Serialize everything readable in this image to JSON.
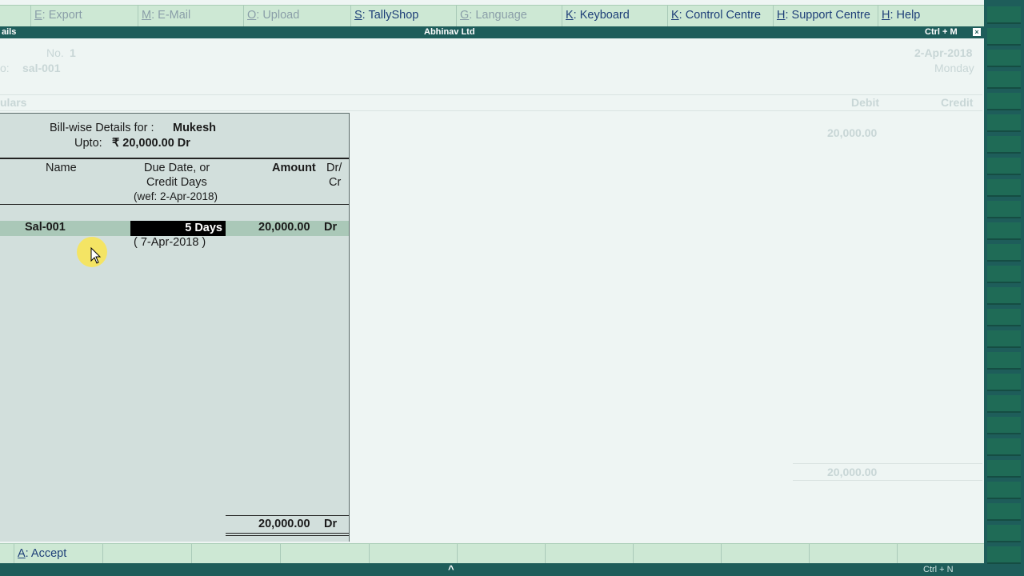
{
  "top_menu": [
    {
      "key": "E",
      "label": ": Export",
      "enabled": false
    },
    {
      "key": "M",
      "label": ": E-Mail",
      "enabled": false
    },
    {
      "key": "O",
      "label": ": Upload",
      "enabled": false
    },
    {
      "key": "S",
      "label": ": TallyShop",
      "enabled": true
    },
    {
      "key": "G",
      "label": ": Language",
      "enabled": false
    },
    {
      "key": "K",
      "label": ": Keyboard",
      "enabled": true
    },
    {
      "key": "K",
      "label": ": Control Centre",
      "enabled": true
    },
    {
      "key": "H",
      "label": ": Support Centre",
      "enabled": true
    },
    {
      "key": "H",
      "label": ": Help",
      "enabled": true
    }
  ],
  "titlebar": {
    "left": "ails",
    "company": "Abhinav Ltd",
    "shortcut": "Ctrl + M",
    "close": "×"
  },
  "voucher_bg": {
    "no_label": "No.",
    "no_value": "1",
    "ref_label": "o:",
    "ref_value": "sal-001",
    "date": "2-Apr-2018",
    "day": "Monday",
    "particulars": "ulars",
    "debit": "Debit",
    "credit": "Credit",
    "amount_top": "20,000.00",
    "amount_total": "20,000.00"
  },
  "billwise": {
    "title_prefix": "Bill-wise Details for :",
    "party": "Mukesh",
    "upto_label": "Upto:",
    "upto_value": "₹ 20,000.00 Dr",
    "col_name": "Name",
    "col_due_1": "Due Date, or",
    "col_due_2": "Credit Days",
    "col_due_3": "(wef: 2-Apr-2018)",
    "col_amount": "Amount",
    "col_drcr_1": "Dr/",
    "col_drcr_2": "Cr",
    "row_name": "Sal-001",
    "row_days": "5 Days",
    "row_amount": "20,000.00",
    "row_drcr": "Dr",
    "row_due_date": "( 7-Apr-2018 )",
    "total_amount": "20,000.00",
    "total_drcr": "Dr"
  },
  "bottom": {
    "accept_key": "A",
    "accept_label": ": Accept"
  },
  "status": {
    "arrow": "^",
    "shortcut": "Ctrl + N"
  }
}
